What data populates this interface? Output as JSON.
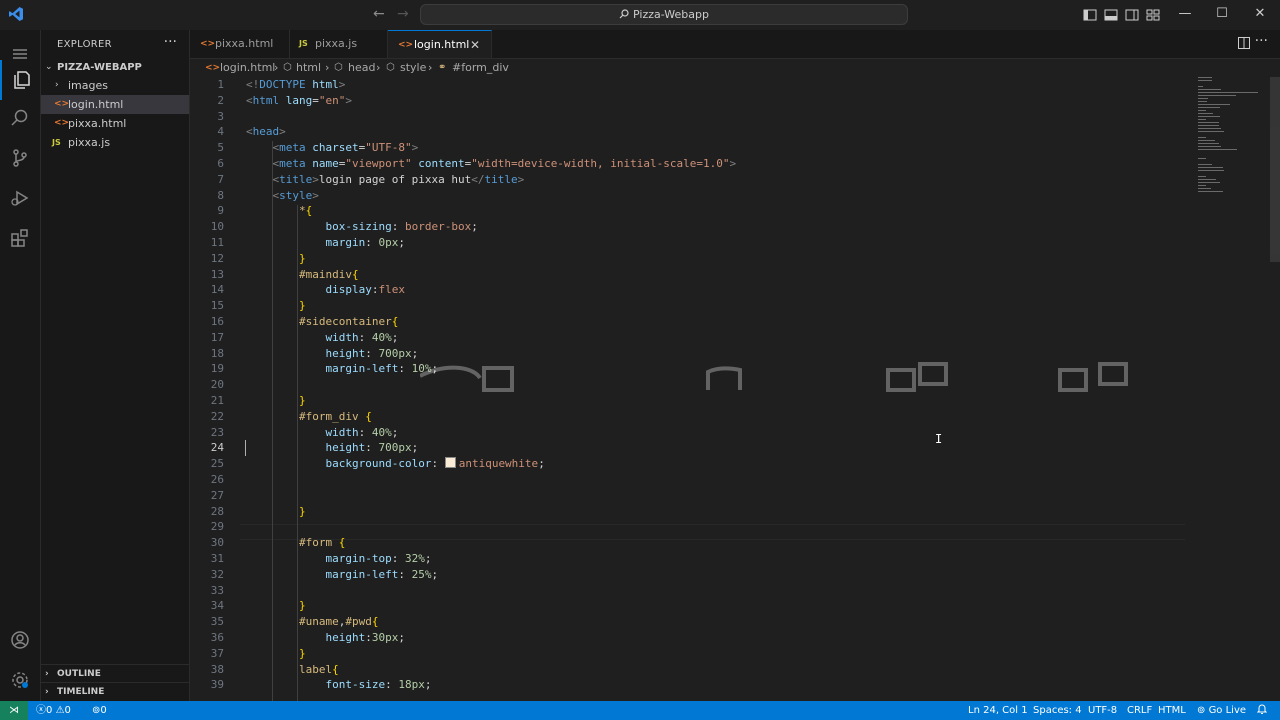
{
  "window": {
    "title": "Pizza-Webapp",
    "back_arrow": "←",
    "forward_arrow": "→",
    "search_glyph": "⌕",
    "minimize": "—",
    "maximize": "☐",
    "close": "✕"
  },
  "sidebar": {
    "header": "EXPLORER",
    "more": "···",
    "project": "PIZZA-WEBAPP",
    "items": [
      {
        "label": "images",
        "type": "folder",
        "selected": false
      },
      {
        "label": "login.html",
        "type": "html",
        "selected": true
      },
      {
        "label": "pixxa.html",
        "type": "html",
        "selected": false
      },
      {
        "label": "pixxa.js",
        "type": "js",
        "selected": false
      }
    ],
    "outline": "OUTLINE",
    "timeline": "TIMELINE",
    "icons": {
      "html": "<>",
      "js": "JS",
      "chevron_right": "›",
      "chevron_down": "⌄"
    }
  },
  "tabs": [
    {
      "label": "pixxa.html",
      "icon": "<>",
      "active": false
    },
    {
      "label": "pixxa.js",
      "icon": "JS",
      "active": false
    },
    {
      "label": "login.html",
      "icon": "<>",
      "active": true,
      "close": "✕"
    }
  ],
  "breadcrumb": [
    "login.html",
    "html",
    "head",
    "style",
    "#form_div"
  ],
  "breadcrumb_sep": "›",
  "editor": {
    "current_line": 24,
    "lines": [
      {
        "n": "1",
        "parts": [
          [
            "t-tag",
            "<!"
          ],
          [
            "t-name",
            "DOCTYPE"
          ],
          [
            "t-text",
            " "
          ],
          [
            "t-attr",
            "html"
          ],
          [
            "t-tag",
            ">"
          ]
        ]
      },
      {
        "n": "2",
        "parts": [
          [
            "t-tag",
            "<"
          ],
          [
            "t-name",
            "html"
          ],
          [
            "t-text",
            " "
          ],
          [
            "t-attr",
            "lang"
          ],
          [
            "t-punc",
            "="
          ],
          [
            "t-str",
            "\"en\""
          ],
          [
            "t-tag",
            ">"
          ]
        ]
      },
      {
        "n": "3",
        "parts": []
      },
      {
        "n": "4",
        "parts": [
          [
            "t-tag",
            "<"
          ],
          [
            "t-name",
            "head"
          ],
          [
            "t-tag",
            ">"
          ]
        ]
      },
      {
        "n": "5",
        "parts": [
          [
            "t-text",
            "    "
          ],
          [
            "t-tag",
            "<"
          ],
          [
            "t-name",
            "meta"
          ],
          [
            "t-text",
            " "
          ],
          [
            "t-attr",
            "charset"
          ],
          [
            "t-punc",
            "="
          ],
          [
            "t-str",
            "\"UTF-8\""
          ],
          [
            "t-tag",
            ">"
          ]
        ]
      },
      {
        "n": "6",
        "parts": [
          [
            "t-text",
            "    "
          ],
          [
            "t-tag",
            "<"
          ],
          [
            "t-name",
            "meta"
          ],
          [
            "t-text",
            " "
          ],
          [
            "t-attr",
            "name"
          ],
          [
            "t-punc",
            "="
          ],
          [
            "t-str",
            "\"viewport\""
          ],
          [
            "t-text",
            " "
          ],
          [
            "t-attr",
            "content"
          ],
          [
            "t-punc",
            "="
          ],
          [
            "t-str",
            "\"width=device-width, initial-scale=1.0\""
          ],
          [
            "t-tag",
            ">"
          ]
        ]
      },
      {
        "n": "7",
        "parts": [
          [
            "t-text",
            "    "
          ],
          [
            "t-tag",
            "<"
          ],
          [
            "t-name",
            "title"
          ],
          [
            "t-tag",
            ">"
          ],
          [
            "t-text",
            "login page of pixxa hut"
          ],
          [
            "t-tag",
            "</"
          ],
          [
            "t-name",
            "title"
          ],
          [
            "t-tag",
            ">"
          ]
        ]
      },
      {
        "n": "8",
        "parts": [
          [
            "t-text",
            "    "
          ],
          [
            "t-tag",
            "<"
          ],
          [
            "t-name",
            "style"
          ],
          [
            "t-tag",
            ">"
          ]
        ]
      },
      {
        "n": "9",
        "parts": [
          [
            "t-text",
            "        "
          ],
          [
            "t-sel",
            "*"
          ],
          [
            "t-brace",
            "{"
          ]
        ]
      },
      {
        "n": "10",
        "parts": [
          [
            "t-text",
            "            "
          ],
          [
            "t-prop",
            "box-sizing"
          ],
          [
            "t-punc",
            ": "
          ],
          [
            "t-val",
            "border-box"
          ],
          [
            "t-punc",
            ";"
          ]
        ]
      },
      {
        "n": "11",
        "parts": [
          [
            "t-text",
            "            "
          ],
          [
            "t-prop",
            "margin"
          ],
          [
            "t-punc",
            ": "
          ],
          [
            "t-num",
            "0px"
          ],
          [
            "t-punc",
            ";"
          ]
        ]
      },
      {
        "n": "12",
        "parts": [
          [
            "t-text",
            "        "
          ],
          [
            "t-brace",
            "}"
          ]
        ]
      },
      {
        "n": "13",
        "parts": [
          [
            "t-text",
            "        "
          ],
          [
            "t-sel",
            "#maindiv"
          ],
          [
            "t-brace",
            "{"
          ]
        ]
      },
      {
        "n": "14",
        "parts": [
          [
            "t-text",
            "            "
          ],
          [
            "t-prop",
            "display"
          ],
          [
            "t-punc",
            ":"
          ],
          [
            "t-val",
            "flex"
          ]
        ]
      },
      {
        "n": "15",
        "parts": [
          [
            "t-text",
            "        "
          ],
          [
            "t-brace",
            "}"
          ]
        ]
      },
      {
        "n": "16",
        "parts": [
          [
            "t-text",
            "        "
          ],
          [
            "t-sel",
            "#sidecontainer"
          ],
          [
            "t-brace",
            "{"
          ]
        ]
      },
      {
        "n": "17",
        "parts": [
          [
            "t-text",
            "            "
          ],
          [
            "t-prop",
            "width"
          ],
          [
            "t-punc",
            ": "
          ],
          [
            "t-num",
            "40%"
          ],
          [
            "t-punc",
            ";"
          ]
        ]
      },
      {
        "n": "18",
        "parts": [
          [
            "t-text",
            "            "
          ],
          [
            "t-prop",
            "height"
          ],
          [
            "t-punc",
            ": "
          ],
          [
            "t-num",
            "700px"
          ],
          [
            "t-punc",
            ";"
          ]
        ]
      },
      {
        "n": "19",
        "parts": [
          [
            "t-text",
            "            "
          ],
          [
            "t-prop",
            "margin-left"
          ],
          [
            "t-punc",
            ": "
          ],
          [
            "t-num",
            "10%"
          ],
          [
            "t-punc",
            ";"
          ]
        ]
      },
      {
        "n": "20",
        "parts": []
      },
      {
        "n": "21",
        "parts": [
          [
            "t-text",
            "        "
          ],
          [
            "t-brace",
            "}"
          ]
        ]
      },
      {
        "n": "22",
        "parts": [
          [
            "t-text",
            "        "
          ],
          [
            "t-sel",
            "#form_div"
          ],
          [
            "t-text",
            " "
          ],
          [
            "t-brace",
            "{"
          ]
        ]
      },
      {
        "n": "23",
        "parts": [
          [
            "t-text",
            "            "
          ],
          [
            "t-prop",
            "width"
          ],
          [
            "t-punc",
            ": "
          ],
          [
            "t-num",
            "40%"
          ],
          [
            "t-punc",
            ";"
          ]
        ]
      },
      {
        "n": "24",
        "parts": [
          [
            "t-text",
            "            "
          ],
          [
            "t-prop",
            "height"
          ],
          [
            "t-punc",
            ": "
          ],
          [
            "t-num",
            "700px"
          ],
          [
            "t-punc",
            ";"
          ]
        ]
      },
      {
        "n": "25",
        "parts": [
          [
            "t-text",
            "            "
          ],
          [
            "t-prop",
            "background-color"
          ],
          [
            "t-punc",
            ": "
          ],
          [
            "swatch",
            ""
          ],
          [
            "t-val",
            "antiquewhite"
          ],
          [
            "t-punc",
            ";"
          ]
        ]
      },
      {
        "n": "26",
        "parts": []
      },
      {
        "n": "27",
        "parts": []
      },
      {
        "n": "28",
        "parts": [
          [
            "t-text",
            "        "
          ],
          [
            "t-brace",
            "}"
          ]
        ]
      },
      {
        "n": "29",
        "parts": []
      },
      {
        "n": "30",
        "parts": [
          [
            "t-text",
            "        "
          ],
          [
            "t-sel",
            "#form"
          ],
          [
            "t-text",
            " "
          ],
          [
            "t-brace",
            "{"
          ]
        ]
      },
      {
        "n": "31",
        "parts": [
          [
            "t-text",
            "            "
          ],
          [
            "t-prop",
            "margin-top"
          ],
          [
            "t-punc",
            ": "
          ],
          [
            "t-num",
            "32%"
          ],
          [
            "t-punc",
            ";"
          ]
        ]
      },
      {
        "n": "32",
        "parts": [
          [
            "t-text",
            "            "
          ],
          [
            "t-prop",
            "margin-left"
          ],
          [
            "t-punc",
            ": "
          ],
          [
            "t-num",
            "25%"
          ],
          [
            "t-punc",
            ";"
          ]
        ]
      },
      {
        "n": "33",
        "parts": []
      },
      {
        "n": "34",
        "parts": [
          [
            "t-text",
            "        "
          ],
          [
            "t-brace",
            "}"
          ]
        ]
      },
      {
        "n": "35",
        "parts": [
          [
            "t-text",
            "        "
          ],
          [
            "t-sel",
            "#uname"
          ],
          [
            "t-punc",
            ","
          ],
          [
            "t-sel",
            "#pwd"
          ],
          [
            "t-brace",
            "{"
          ]
        ]
      },
      {
        "n": "36",
        "parts": [
          [
            "t-text",
            "            "
          ],
          [
            "t-prop",
            "height"
          ],
          [
            "t-punc",
            ":"
          ],
          [
            "t-num",
            "30px"
          ],
          [
            "t-punc",
            ";"
          ]
        ]
      },
      {
        "n": "37",
        "parts": [
          [
            "t-text",
            "        "
          ],
          [
            "t-brace",
            "}"
          ]
        ]
      },
      {
        "n": "38",
        "parts": [
          [
            "t-text",
            "        "
          ],
          [
            "t-sel",
            "label"
          ],
          [
            "t-brace",
            "{"
          ]
        ]
      },
      {
        "n": "39",
        "parts": [
          [
            "t-text",
            "            "
          ],
          [
            "t-prop",
            "font-size"
          ],
          [
            "t-punc",
            ": "
          ],
          [
            "t-num",
            "18px"
          ],
          [
            "t-punc",
            ";"
          ]
        ]
      }
    ]
  },
  "statusbar": {
    "remote_icon": "⋊",
    "errors": "0",
    "warnings": "0",
    "ports": "0",
    "position": "Ln 24, Col 1",
    "spaces": "Spaces: 4",
    "encoding": "UTF-8",
    "eol": "CRLF",
    "language": "HTML",
    "golive": "Go Live",
    "bell": "🔔"
  },
  "colors": {
    "accent": "#0078d4",
    "status_bar": "#0078d4",
    "remote": "#16825d",
    "html_icon": "#e37933",
    "js_icon": "#cbcb41"
  }
}
